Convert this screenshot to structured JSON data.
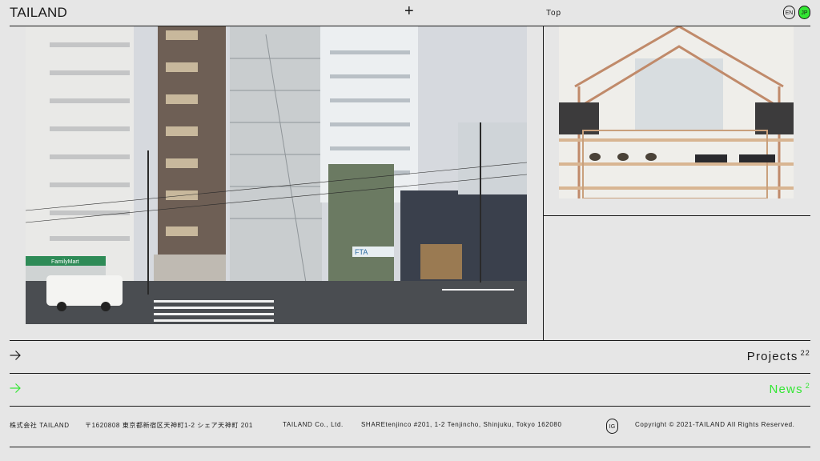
{
  "header": {
    "logo": "TAILAND",
    "menu_icon": "plus-icon",
    "top_link": "Top",
    "lang_en": "EN",
    "lang_jp": "JP"
  },
  "main_image": {
    "subject": "street-view-building-photo",
    "store_sign": "FamilyMart",
    "shop_sign": "FTA"
  },
  "side_image": {
    "subject": "shop-interior-photo"
  },
  "nav": {
    "projects_label": "Projects",
    "projects_count": "22",
    "news_label": "News",
    "news_count": "2",
    "arrow_icon": "arrow-right-icon"
  },
  "footer": {
    "company_jp": "株式会社 TAILAND",
    "address_jp": "〒1620808 東京都新宿区天神町1-2 シェア天神町 201",
    "company_en": "TAILAND Co., Ltd.",
    "address_en": "SHAREtenjinco #201, 1-2 Tenjincho, Shinjuku, Tokyo 162080",
    "instagram": "IG",
    "copyright": "Copyright © 2021-TAILAND All Rights Reserved."
  },
  "colors": {
    "background": "#e6e6e6",
    "text": "#1a1a1a",
    "accent_green": "#33e633"
  }
}
